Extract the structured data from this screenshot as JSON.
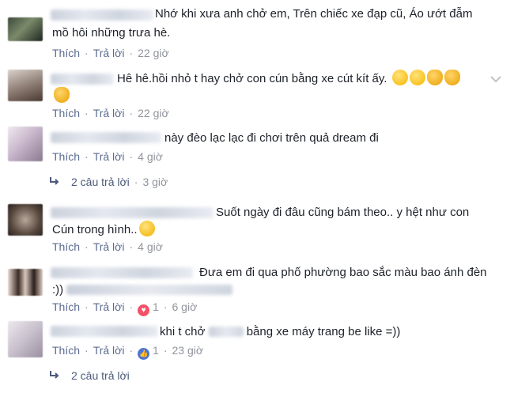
{
  "comments": [
    {
      "text_line1": "Nhớ khi xưa anh chở em, Trên chiếc xe đạp cũ, Áo ướt đẫm",
      "text_line2": "mồ hôi những trưa hè.",
      "like_label": "Thích",
      "reply_label": "Trả lời",
      "time": "22 giờ"
    },
    {
      "text_line1": "Hê hê.hồi nhỏ t hay chở con cún bằng xe cút kít ấy.",
      "like_label": "Thích",
      "reply_label": "Trả lời",
      "time": "22 giờ"
    },
    {
      "text_line1": "này đèo lạc lạc đi chơi trên quả dream đi",
      "like_label": "Thích",
      "reply_label": "Trả lời",
      "time": "4 giờ",
      "replies_label": "2 câu trả lời",
      "replies_time": "3 giờ"
    },
    {
      "text_line1": "Suốt ngày đi đâu cũng bám theo.. y hệt như con",
      "text_line2": "Cún trong hình..",
      "like_label": "Thích",
      "reply_label": "Trả lời",
      "time": "4 giờ"
    },
    {
      "text_line1": "Đưa em đi qua phố phường bao sắc màu bao ánh đèn",
      "text_line2": ":))",
      "like_label": "Thích",
      "reply_label": "Trả lời",
      "reaction_count": "1",
      "time": "6 giờ"
    },
    {
      "text_pre": "khi t chở",
      "text_post": "bằng xe máy trang be like =))",
      "like_label": "Thích",
      "reply_label": "Trả lời",
      "reaction_count": "1",
      "time": "23 giờ",
      "replies_label": "2 câu trả lời"
    }
  ],
  "colors": {
    "text": "#1d2129",
    "meta": "#90949c",
    "link": "#4b5a7a",
    "heart": "#f25268",
    "like": "#4e75d6"
  }
}
